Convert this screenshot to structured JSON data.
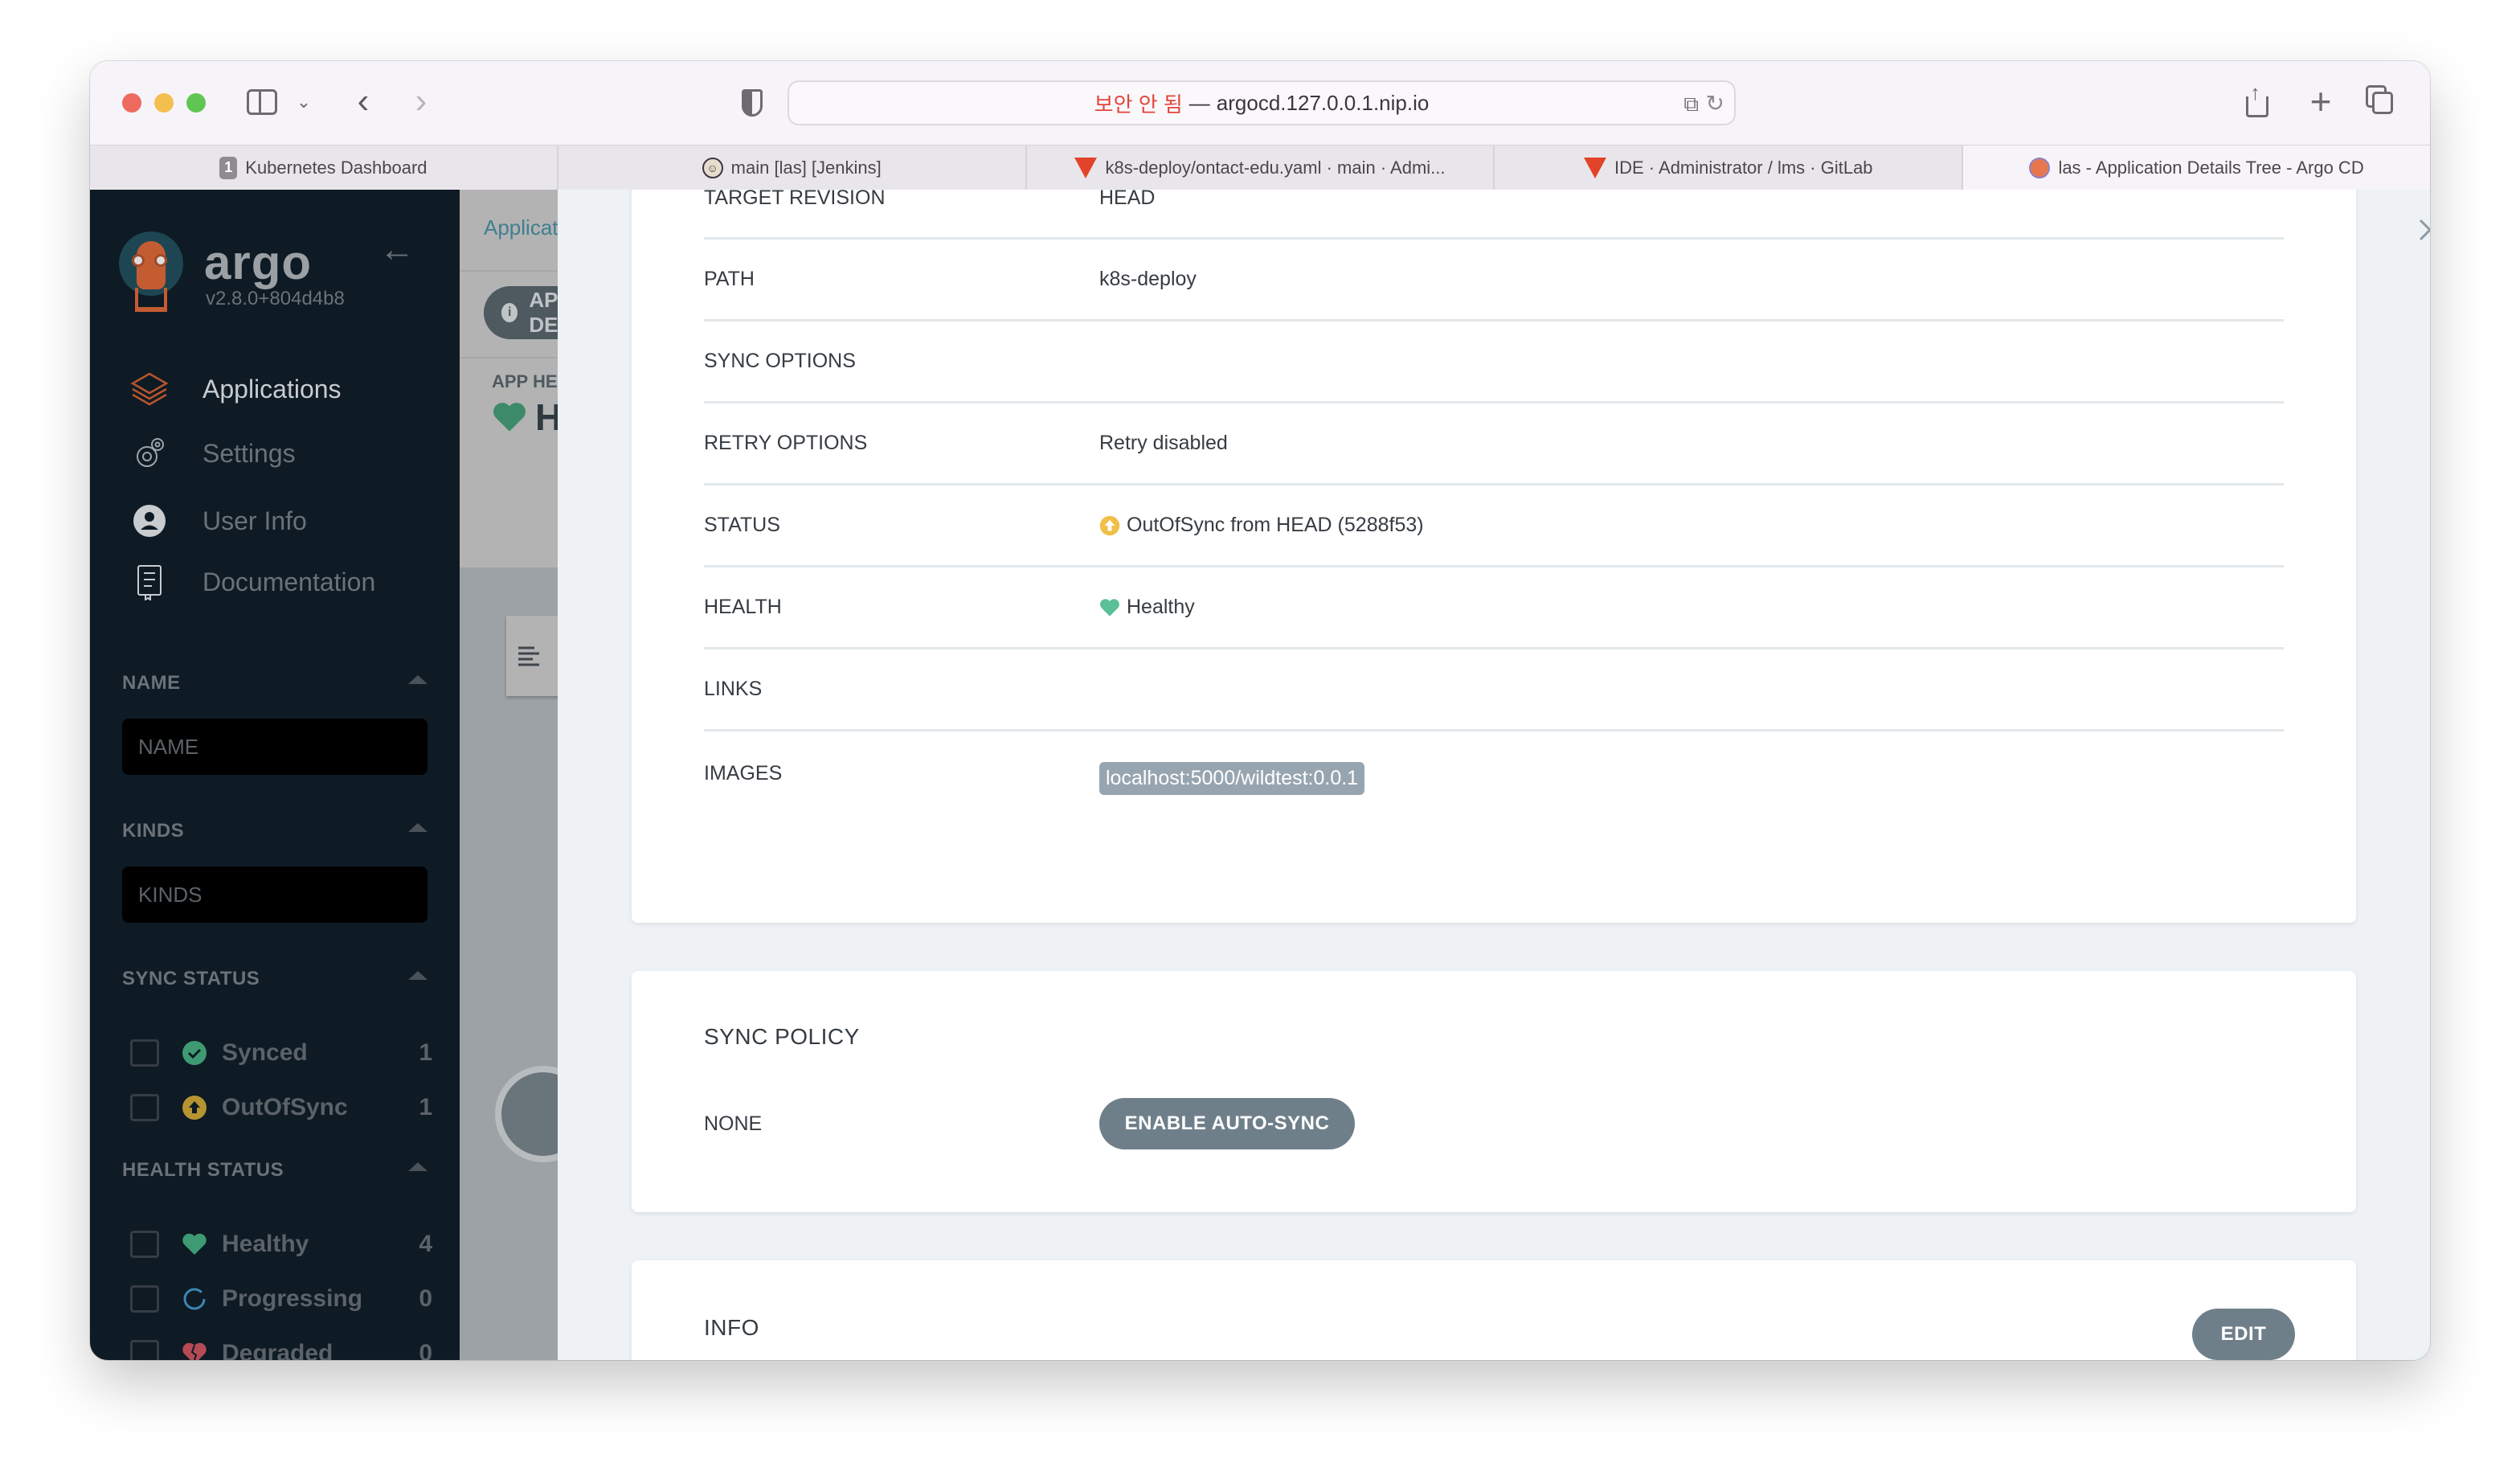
{
  "browser": {
    "url": {
      "insecure_label": "보안 안 됨",
      "separator": "—",
      "host": "argocd.127.0.0.1.nip.io"
    },
    "tabs": [
      {
        "label": "Kubernetes Dashboard",
        "icon": "kubernetes-dashboard-icon",
        "badge": "1",
        "active": false
      },
      {
        "label": "main [las] [Jenkins]",
        "icon": "jenkins-icon",
        "active": false
      },
      {
        "label": "k8s-deploy/ontact-edu.yaml · main · Admi...",
        "icon": "gitlab-icon",
        "active": false
      },
      {
        "label": "IDE · Administrator / lms · GitLab",
        "icon": "gitlab-icon",
        "active": false
      },
      {
        "label": "las - Application Details Tree - Argo CD",
        "icon": "argo-icon",
        "active": true
      }
    ]
  },
  "sidebar": {
    "brand": "argo",
    "version": "v2.8.0+804d4b8",
    "nav": [
      {
        "label": "Applications",
        "icon": "layers-icon",
        "active": true
      },
      {
        "label": "Settings",
        "icon": "gears-icon",
        "active": false
      },
      {
        "label": "User Info",
        "icon": "user-circle-icon",
        "active": false
      },
      {
        "label": "Documentation",
        "icon": "book-icon",
        "active": false
      }
    ],
    "filters": {
      "name": {
        "title": "NAME",
        "placeholder": "NAME"
      },
      "kinds": {
        "title": "KINDS",
        "placeholder": "KINDS"
      },
      "sync_status": {
        "title": "SYNC STATUS",
        "items": [
          {
            "label": "Synced",
            "count": "1",
            "color": "#3d9a72"
          },
          {
            "label": "OutOfSync",
            "count": "1",
            "color": "#b59431"
          }
        ]
      },
      "health_status": {
        "title": "HEALTH STATUS",
        "items": [
          {
            "label": "Healthy",
            "count": "4",
            "color": "#3d9a72"
          },
          {
            "label": "Progressing",
            "count": "0",
            "color": "#3c86b3"
          },
          {
            "label": "Degraded",
            "count": "0",
            "color": "#b54a55"
          }
        ]
      }
    }
  },
  "background_page": {
    "breadcrumb": "Applications",
    "details_button": "APP DETAILS",
    "health_label": "APP HEALTH",
    "health_value": "Healthy"
  },
  "panel": {
    "summary_rows": [
      {
        "key": "TARGET REVISION",
        "value": "HEAD"
      },
      {
        "key": "PATH",
        "value": "k8s-deploy"
      },
      {
        "key": "SYNC OPTIONS",
        "value": ""
      },
      {
        "key": "RETRY OPTIONS",
        "value": "Retry disabled"
      },
      {
        "key": "STATUS",
        "value": "OutOfSync from HEAD (5288f53)",
        "icon": "outofsync-icon"
      },
      {
        "key": "HEALTH",
        "value": "Healthy",
        "icon": "heart-icon"
      },
      {
        "key": "LINKS",
        "value": ""
      },
      {
        "key": "IMAGES",
        "value": "localhost:5000/wildtest:0.0.1"
      }
    ],
    "sync_policy": {
      "title": "SYNC POLICY",
      "key": "NONE",
      "button": "ENABLE AUTO-SYNC"
    },
    "info": {
      "title": "INFO",
      "button": "EDIT"
    }
  },
  "colors": {
    "accent_orange": "#e96d4b",
    "synced_green": "#5bbf98",
    "outofsync_yellow": "#f0bf46",
    "button_slate": "#6f7f8a",
    "sidebar_bg": "#0e1a24"
  }
}
